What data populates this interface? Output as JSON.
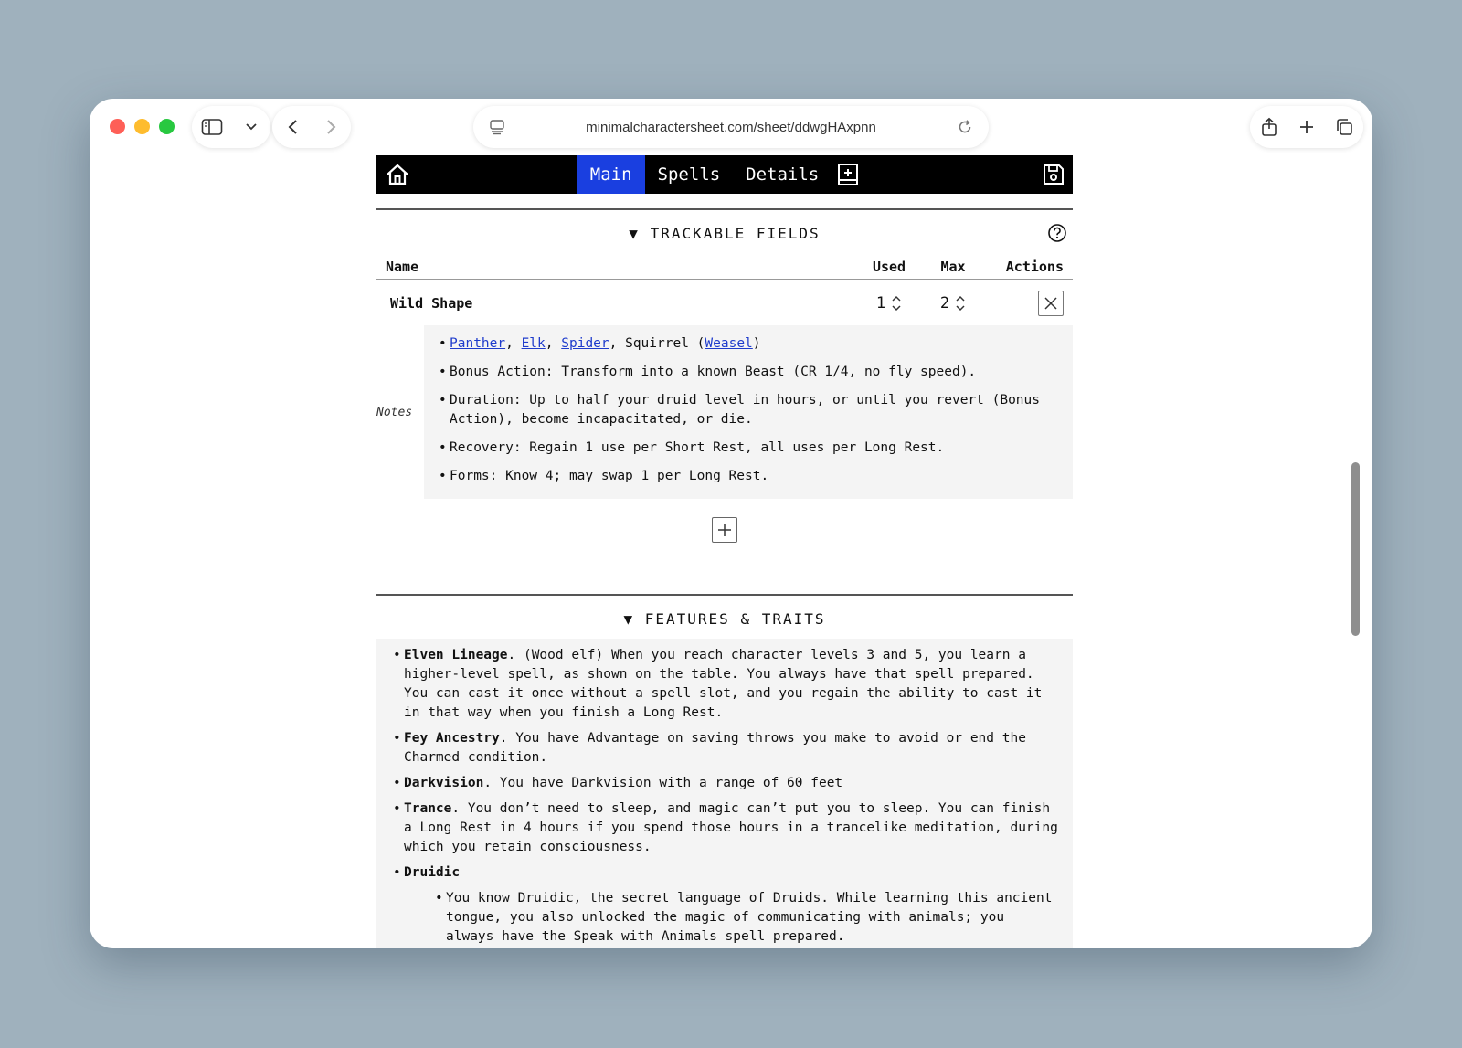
{
  "browser": {
    "url": "minimalcharactersheet.com/sheet/ddwgHAxpnn"
  },
  "nav": {
    "tabs": [
      {
        "label": "Main",
        "active": true
      },
      {
        "label": "Spells",
        "active": false
      },
      {
        "label": "Details",
        "active": false
      }
    ]
  },
  "trackable": {
    "title": "▼ TRACKABLE FIELDS",
    "headers": {
      "name": "Name",
      "used": "Used",
      "max": "Max",
      "actions": "Actions"
    },
    "row": {
      "name": "Wild Shape",
      "used": "1",
      "max": "2",
      "notes_label": "Notes",
      "notes": {
        "forms": {
          "panther": "Panther",
          "sep1": ", ",
          "elk": "Elk",
          "sep2": ", ",
          "spider": "Spider",
          "squirrel": ", Squirrel (",
          "weasel": "Weasel",
          "close": ")"
        },
        "lines": [
          "Bonus Action: Transform into a known Beast (CR 1/4, no fly speed).",
          "Duration: Up to half your druid level in hours, or until you revert (Bonus Action), become incapacitated, or die.",
          "Recovery: Regain 1 use per Short Rest, all uses per Long Rest.",
          "Forms: Know 4; may swap 1 per Long Rest."
        ]
      }
    }
  },
  "features": {
    "title": "▼ FEATURES & TRAITS",
    "items": [
      {
        "name": "Elven Lineage",
        "text": ". (Wood elf) When you reach character levels 3 and 5, you learn a higher-level spell, as shown on the table. You always have that spell prepared. You can cast it once without a spell slot, and you regain the ability to cast it in that way when you finish a Long Rest."
      },
      {
        "name": "Fey Ancestry",
        "text": ". You have Advantage on saving throws you make to avoid or end the Charmed condition."
      },
      {
        "name": "Darkvision",
        "text": ". You have Darkvision with a range of 60 feet"
      },
      {
        "name": "Trance",
        "text": ". You don’t need to sleep, and magic can’t put you to sleep. You can finish a Long Rest in 4 hours if you spend those hours in a trancelike meditation, during which you retain consciousness."
      },
      {
        "name": "Druidic",
        "text": ""
      }
    ],
    "druidic_sub": "You know Druidic, the secret language of Druids. While learning this ancient tongue, you also unlocked the magic of communicating with animals; you always have the Speak with Animals spell prepared."
  }
}
